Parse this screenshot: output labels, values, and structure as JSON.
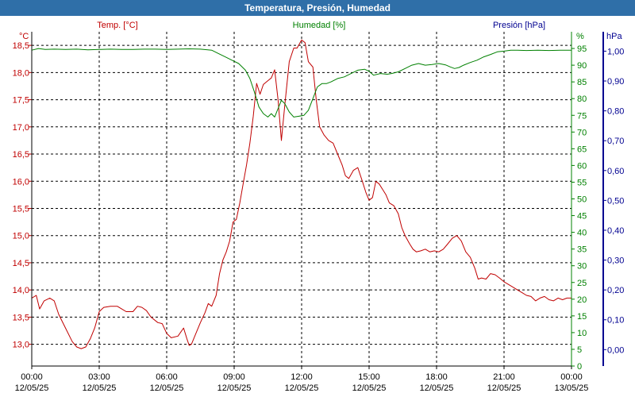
{
  "chart_data": {
    "type": "line",
    "title": "Temperatura, Presión, Humedad",
    "axis_labels": {
      "temperature": "Temp. [°C]",
      "humidity": "Humedad [%]",
      "pressure": "Presión [hPa]",
      "temperature_unit": "°C",
      "humidity_unit": "%",
      "pressure_unit": "hPa"
    },
    "colors": {
      "temperature": "#c00000",
      "humidity": "#008000",
      "pressure": "#000090",
      "title_bar": "#2f6fa8",
      "grid": "#000000"
    },
    "x_ticks": [
      {
        "time": "00:00",
        "date": "12/05/25"
      },
      {
        "time": "03:00",
        "date": "12/05/25"
      },
      {
        "time": "06:00",
        "date": "12/05/25"
      },
      {
        "time": "09:00",
        "date": "12/05/25"
      },
      {
        "time": "12:00",
        "date": "12/05/25"
      },
      {
        "time": "15:00",
        "date": "12/05/25"
      },
      {
        "time": "18:00",
        "date": "12/05/25"
      },
      {
        "time": "21:00",
        "date": "12/05/25"
      },
      {
        "time": "00:00",
        "date": "13/05/25"
      }
    ],
    "x_range_hours": [
      0,
      24
    ],
    "temperature_ticks": [
      "18,5",
      "18,0",
      "17,5",
      "17,0",
      "16,5",
      "16,0",
      "15,5",
      "15,0",
      "14,5",
      "14,0",
      "13,5",
      "13,0"
    ],
    "temperature_range": [
      12.6,
      18.75
    ],
    "humidity_ticks": [
      "95",
      "90",
      "85",
      "80",
      "75",
      "70",
      "65",
      "60",
      "55",
      "50",
      "45",
      "40",
      "35",
      "30",
      "25",
      "20",
      "15",
      "10",
      "5",
      "0"
    ],
    "humidity_range": [
      0,
      100
    ],
    "pressure_ticks": [
      "1,00",
      "0,90",
      "0,80",
      "0,70",
      "0,60",
      "0,50",
      "0,40",
      "0,30",
      "0,20",
      "0,10",
      "0,00"
    ],
    "pressure_range": [
      -0.055,
      1.065
    ],
    "grid": true,
    "series": [
      {
        "name": "Temp. [°C]",
        "axis": "temperature",
        "points": [
          [
            0,
            13.85
          ],
          [
            0.2,
            13.9
          ],
          [
            0.35,
            13.65
          ],
          [
            0.55,
            13.8
          ],
          [
            0.8,
            13.85
          ],
          [
            1.0,
            13.8
          ],
          [
            1.2,
            13.55
          ],
          [
            1.5,
            13.3
          ],
          [
            1.8,
            13.05
          ],
          [
            2.0,
            12.95
          ],
          [
            2.2,
            12.92
          ],
          [
            2.4,
            12.95
          ],
          [
            2.6,
            13.1
          ],
          [
            2.8,
            13.3
          ],
          [
            3.0,
            13.6
          ],
          [
            3.2,
            13.68
          ],
          [
            3.5,
            13.7
          ],
          [
            3.8,
            13.7
          ],
          [
            4.0,
            13.65
          ],
          [
            4.2,
            13.6
          ],
          [
            4.5,
            13.6
          ],
          [
            4.7,
            13.7
          ],
          [
            4.9,
            13.68
          ],
          [
            5.1,
            13.62
          ],
          [
            5.3,
            13.5
          ],
          [
            5.6,
            13.4
          ],
          [
            5.8,
            13.38
          ],
          [
            6.0,
            13.2
          ],
          [
            6.2,
            13.12
          ],
          [
            6.5,
            13.15
          ],
          [
            6.75,
            13.3
          ],
          [
            6.9,
            13.1
          ],
          [
            7.0,
            12.98
          ],
          [
            7.1,
            13.0
          ],
          [
            7.3,
            13.2
          ],
          [
            7.5,
            13.4
          ],
          [
            7.7,
            13.58
          ],
          [
            7.85,
            13.75
          ],
          [
            8.0,
            13.7
          ],
          [
            8.2,
            13.9
          ],
          [
            8.35,
            14.3
          ],
          [
            8.5,
            14.55
          ],
          [
            8.65,
            14.7
          ],
          [
            8.8,
            14.9
          ],
          [
            8.95,
            15.25
          ],
          [
            9.1,
            15.3
          ],
          [
            9.25,
            15.6
          ],
          [
            9.4,
            15.95
          ],
          [
            9.55,
            16.3
          ],
          [
            9.7,
            16.7
          ],
          [
            9.85,
            17.2
          ],
          [
            10.0,
            17.8
          ],
          [
            10.15,
            17.6
          ],
          [
            10.3,
            17.78
          ],
          [
            10.5,
            17.85
          ],
          [
            10.65,
            17.9
          ],
          [
            10.8,
            18.05
          ],
          [
            10.95,
            17.5
          ],
          [
            11.1,
            16.75
          ],
          [
            11.25,
            17.4
          ],
          [
            11.45,
            18.2
          ],
          [
            11.65,
            18.45
          ],
          [
            11.8,
            18.45
          ],
          [
            12.0,
            18.6
          ],
          [
            12.15,
            18.55
          ],
          [
            12.3,
            18.2
          ],
          [
            12.5,
            18.1
          ],
          [
            12.65,
            17.5
          ],
          [
            12.8,
            17.0
          ],
          [
            13.0,
            16.85
          ],
          [
            13.2,
            16.75
          ],
          [
            13.4,
            16.7
          ],
          [
            13.6,
            16.5
          ],
          [
            13.8,
            16.3
          ],
          [
            13.95,
            16.1
          ],
          [
            14.1,
            16.05
          ],
          [
            14.3,
            16.2
          ],
          [
            14.5,
            16.25
          ],
          [
            14.7,
            16.0
          ],
          [
            14.85,
            15.8
          ],
          [
            15.0,
            15.65
          ],
          [
            15.15,
            15.7
          ],
          [
            15.3,
            16.0
          ],
          [
            15.45,
            15.95
          ],
          [
            15.6,
            15.85
          ],
          [
            15.75,
            15.75
          ],
          [
            15.9,
            15.6
          ],
          [
            16.1,
            15.55
          ],
          [
            16.3,
            15.4
          ],
          [
            16.45,
            15.15
          ],
          [
            16.6,
            15.0
          ],
          [
            16.8,
            14.85
          ],
          [
            16.95,
            14.75
          ],
          [
            17.1,
            14.7
          ],
          [
            17.3,
            14.72
          ],
          [
            17.5,
            14.75
          ],
          [
            17.7,
            14.7
          ],
          [
            17.9,
            14.72
          ],
          [
            18.1,
            14.7
          ],
          [
            18.3,
            14.75
          ],
          [
            18.5,
            14.85
          ],
          [
            18.7,
            14.95
          ],
          [
            18.9,
            15.0
          ],
          [
            19.1,
            14.9
          ],
          [
            19.3,
            14.7
          ],
          [
            19.5,
            14.6
          ],
          [
            19.7,
            14.4
          ],
          [
            19.85,
            14.2
          ],
          [
            20.0,
            14.22
          ],
          [
            20.2,
            14.2
          ],
          [
            20.4,
            14.3
          ],
          [
            20.6,
            14.28
          ],
          [
            20.8,
            14.22
          ],
          [
            21.0,
            14.15
          ],
          [
            21.2,
            14.1
          ],
          [
            21.4,
            14.05
          ],
          [
            21.6,
            14.0
          ],
          [
            21.8,
            13.95
          ],
          [
            22.0,
            13.9
          ],
          [
            22.2,
            13.88
          ],
          [
            22.4,
            13.8
          ],
          [
            22.6,
            13.85
          ],
          [
            22.8,
            13.88
          ],
          [
            23.0,
            13.82
          ],
          [
            23.2,
            13.8
          ],
          [
            23.4,
            13.85
          ],
          [
            23.6,
            13.82
          ],
          [
            23.8,
            13.85
          ],
          [
            24.0,
            13.85
          ]
        ]
      },
      {
        "name": "Humedad [%]",
        "axis": "humidity",
        "points": [
          [
            0,
            94.5
          ],
          [
            0.3,
            95.0
          ],
          [
            0.6,
            94.7
          ],
          [
            1.0,
            94.8
          ],
          [
            1.5,
            94.7
          ],
          [
            2.0,
            94.8
          ],
          [
            2.5,
            94.6
          ],
          [
            3.0,
            94.7
          ],
          [
            3.5,
            94.8
          ],
          [
            4.0,
            94.7
          ],
          [
            4.5,
            94.7
          ],
          [
            5.0,
            94.8
          ],
          [
            5.5,
            94.8
          ],
          [
            6.0,
            94.7
          ],
          [
            6.5,
            94.8
          ],
          [
            7.0,
            94.9
          ],
          [
            7.5,
            94.8
          ],
          [
            8.0,
            94.5
          ],
          [
            8.3,
            93.5
          ],
          [
            8.6,
            92.5
          ],
          [
            8.9,
            91.5
          ],
          [
            9.2,
            90.5
          ],
          [
            9.5,
            88.5
          ],
          [
            9.7,
            86.0
          ],
          [
            9.9,
            82.0
          ],
          [
            10.1,
            77.5
          ],
          [
            10.3,
            75.5
          ],
          [
            10.5,
            74.5
          ],
          [
            10.65,
            75.5
          ],
          [
            10.8,
            74.5
          ],
          [
            10.95,
            77.0
          ],
          [
            11.1,
            79.5
          ],
          [
            11.25,
            78.5
          ],
          [
            11.45,
            76.0
          ],
          [
            11.65,
            74.5
          ],
          [
            11.85,
            74.7
          ],
          [
            12.1,
            75.0
          ],
          [
            12.3,
            76.5
          ],
          [
            12.5,
            80.0
          ],
          [
            12.7,
            83.5
          ],
          [
            12.9,
            84.5
          ],
          [
            13.1,
            84.5
          ],
          [
            13.3,
            85.0
          ],
          [
            13.6,
            86.0
          ],
          [
            13.9,
            86.5
          ],
          [
            14.2,
            87.5
          ],
          [
            14.5,
            88.5
          ],
          [
            14.8,
            88.8
          ],
          [
            15.0,
            88.2
          ],
          [
            15.2,
            87.0
          ],
          [
            15.5,
            87.5
          ],
          [
            15.8,
            87.3
          ],
          [
            16.0,
            87.5
          ],
          [
            16.3,
            88.0
          ],
          [
            16.6,
            89.0
          ],
          [
            16.9,
            90.0
          ],
          [
            17.2,
            90.5
          ],
          [
            17.5,
            90.0
          ],
          [
            17.8,
            90.2
          ],
          [
            18.1,
            90.5
          ],
          [
            18.4,
            90.1
          ],
          [
            18.6,
            89.5
          ],
          [
            18.8,
            89.0
          ],
          [
            19.0,
            89.3
          ],
          [
            19.2,
            90.0
          ],
          [
            19.5,
            90.8
          ],
          [
            19.8,
            91.5
          ],
          [
            20.1,
            92.5
          ],
          [
            20.4,
            93.2
          ],
          [
            20.7,
            94.0
          ],
          [
            21.0,
            94.2
          ],
          [
            21.3,
            94.5
          ],
          [
            21.6,
            94.5
          ],
          [
            22.0,
            94.4
          ],
          [
            22.5,
            94.5
          ],
          [
            23.0,
            94.4
          ],
          [
            23.5,
            94.5
          ],
          [
            24.0,
            94.5
          ]
        ]
      }
    ]
  }
}
